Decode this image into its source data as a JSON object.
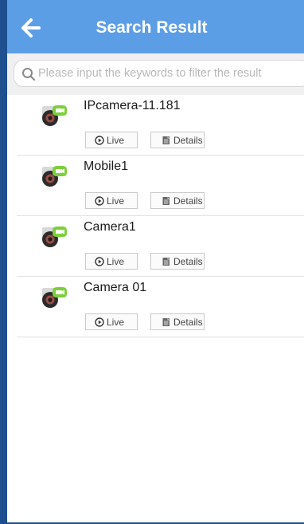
{
  "header": {
    "title": "Search Result",
    "back_icon": "back-arrow-icon"
  },
  "search": {
    "placeholder": "Please input the keywords to filter the result",
    "value": "",
    "icon": "search-icon"
  },
  "devices": [
    {
      "name": "IPcamera-11.181",
      "live_label": "Live",
      "details_label": "Details"
    },
    {
      "name": "Mobile1",
      "live_label": "Live",
      "details_label": "Details"
    },
    {
      "name": "Camera1",
      "live_label": "Live",
      "details_label": "Details"
    },
    {
      "name": "Camera 01",
      "live_label": "Live",
      "details_label": "Details"
    }
  ],
  "colors": {
    "header_bg": "#5c9ee6",
    "frame_border": "#1e4f8f",
    "camera_accent": "#7ccf3a"
  }
}
